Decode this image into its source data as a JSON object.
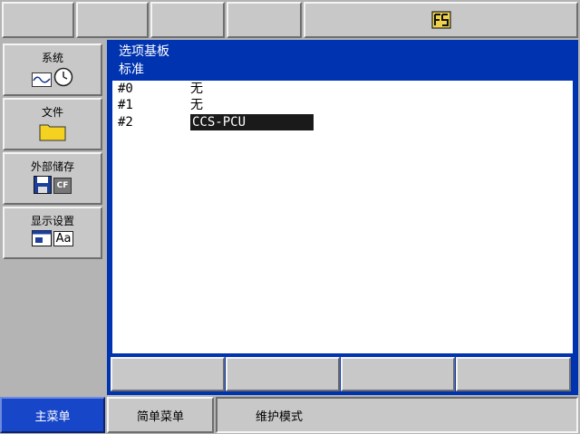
{
  "sidebar": {
    "items": [
      {
        "label": "系统",
        "icons": [
          "waveform-icon",
          "clock-icon"
        ]
      },
      {
        "label": "文件",
        "icons": [
          "folder-icon"
        ]
      },
      {
        "label": "外部储存",
        "icons": [
          "floppy-disk-icon",
          "cf-card-icon"
        ]
      },
      {
        "label": "显示设置",
        "icons": [
          "window-icon",
          "font-aa-icon"
        ]
      }
    ],
    "cf_text": "CF",
    "aa_text": "Aa"
  },
  "main": {
    "title_line1": "选项基板",
    "title_line2": "标准",
    "rows": [
      {
        "key": "#0",
        "value": "无"
      },
      {
        "key": "#1",
        "value": "无"
      },
      {
        "key": "#2",
        "value": "CCS-PCU"
      }
    ]
  },
  "bottom": {
    "main_menu": "主菜单",
    "simple_menu": "简单菜单",
    "status": "维护模式"
  },
  "colors": {
    "panel_blue": "#0033b0",
    "active_blue": "#1846c8",
    "selection": "#1a1a1a",
    "button_gray": "#c8c8c8",
    "background_gray": "#b4b4b4"
  }
}
